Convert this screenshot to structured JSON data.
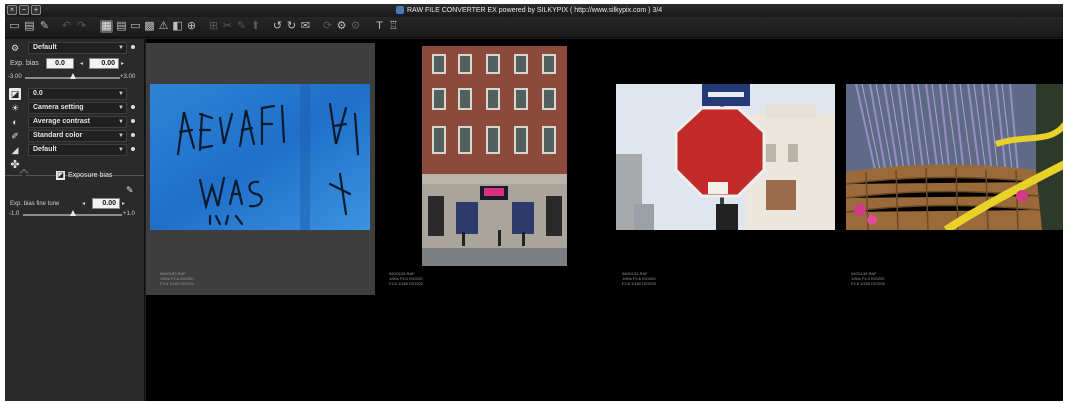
{
  "window": {
    "title": "RAW FILE CONVERTER EX powered by SILKYPIX ( http://www.silkypix.com )  3/4"
  },
  "left_panel": {
    "tone_preset": "Default",
    "exposure_bias_label": "Exp. bias",
    "exposure_bias_value": "0.0",
    "exposure_bias_input": "0.00",
    "exposure_bias_min": "-3.00",
    "exposure_bias_max": "+3.00",
    "exposure_bias_level": 0.0,
    "white_balance_value": "0.0",
    "wb_setting": "Camera setting",
    "contrast": "Average contrast",
    "color": "Standard color",
    "sharpness": "Default",
    "exposure_bias_tab": "Exposure bias",
    "fine_tune_label": "Exp. bias fine tune",
    "fine_tune_value": "0.00",
    "fine_tune_min": "-1.0",
    "fine_tune_max": "+1.0",
    "fine_tune_level": 0.0
  },
  "thumbnails": [
    {
      "name": "graffiti",
      "selected": true,
      "meta": [
        "IMG0150.RAF",
        "1/80s F2.8 ISO200",
        "F2.8 1/160 ISO200"
      ]
    },
    {
      "name": "building",
      "selected": false,
      "meta": [
        "IMG0126.RAF",
        "1/60s F4.0 ISO200",
        "F4.0 1/160 ISO200"
      ]
    },
    {
      "name": "stop-sign",
      "selected": false,
      "meta": [
        "IMG0132.RAF",
        "1/60s F5.6 ISO200",
        "F2.8 1/160 ISO200"
      ]
    },
    {
      "name": "lavender",
      "selected": false,
      "meta": [
        "IMG0138.RAF",
        "1/60s F4.0 ISO200",
        "F2.8 1/250 ISO200"
      ]
    }
  ],
  "colors": {
    "panel_bg": "#2a2a2a",
    "browser_bg": "#000000",
    "selection": "#3e3e3e",
    "accent_blue": "#4a78b8"
  }
}
